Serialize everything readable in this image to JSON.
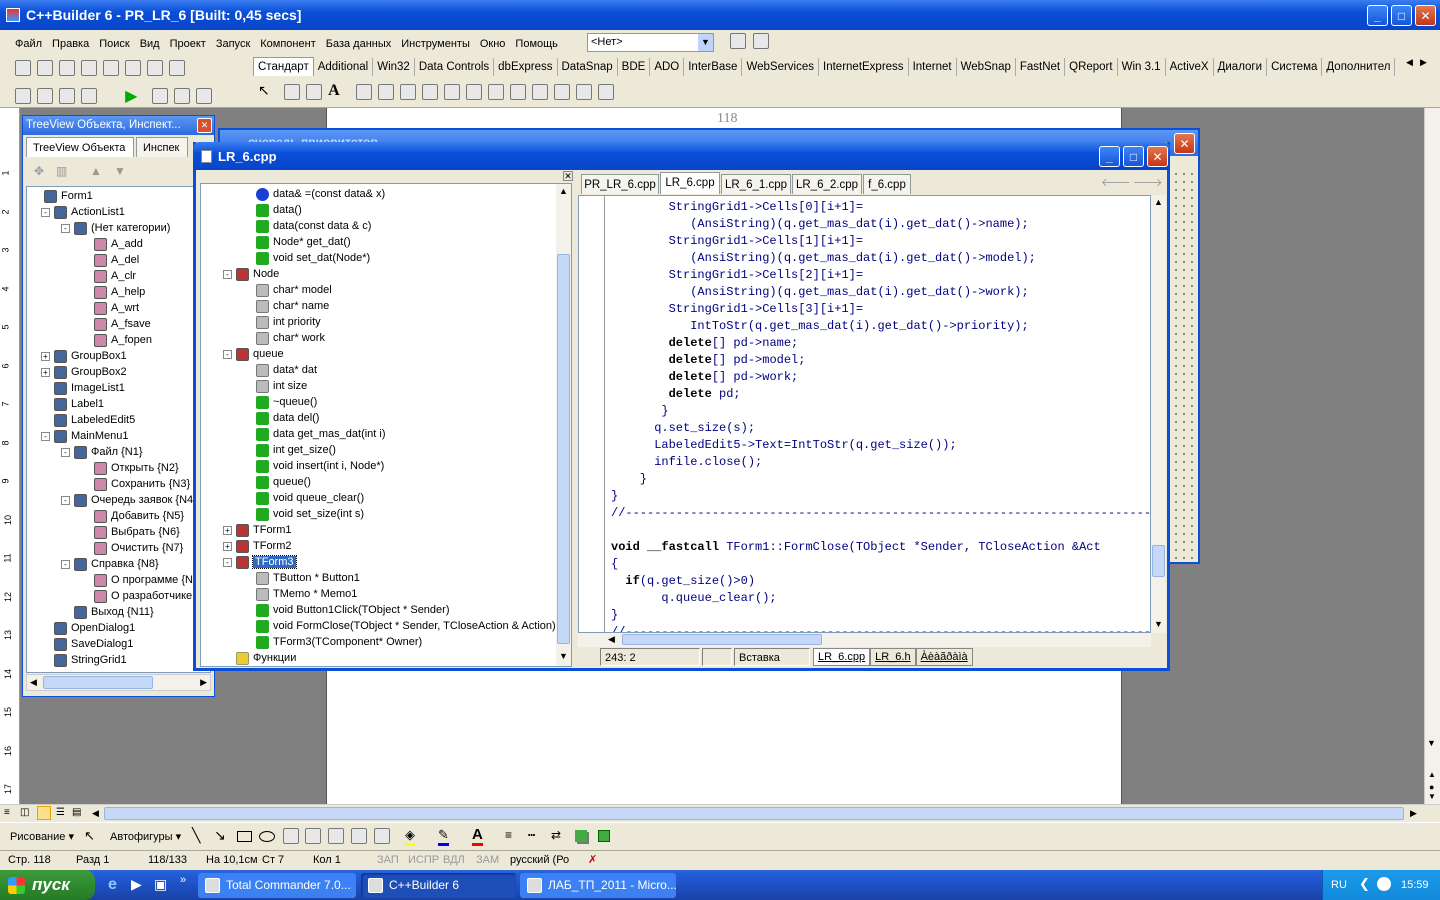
{
  "app": {
    "title": "C++Builder 6 - PR_LR_6 [Built: 0,45 secs]",
    "menu": [
      "Файл",
      "Правка",
      "Поиск",
      "Вид",
      "Проект",
      "Запуск",
      "Компонент",
      "База данных",
      "Инструменты",
      "Окно",
      "Помощь"
    ],
    "config_select": "<Нет>",
    "palette_tabs": [
      "Стандарт",
      "Additional",
      "Win32",
      "Data Controls",
      "dbExpress",
      "DataSnap",
      "BDE",
      "ADO",
      "InterBase",
      "WebServices",
      "InternetExpress",
      "Internet",
      "WebSnap",
      "FastNet",
      "QReport",
      "Win 3.1",
      "ActiveX",
      "Диалоги",
      "Система",
      "Дополнител"
    ]
  },
  "treeview": {
    "title": "TreeView Объекта, Инспект...",
    "tabs": [
      "TreeView Объекта",
      "Инспек"
    ],
    "items": [
      {
        "label": "Form1",
        "lvl": 0,
        "exp": ""
      },
      {
        "label": "ActionList1",
        "lvl": 1,
        "exp": "-"
      },
      {
        "label": "(Нет категории)",
        "lvl": 2,
        "exp": "-"
      },
      {
        "label": "A_add",
        "lvl": 3,
        "exp": ""
      },
      {
        "label": "A_del",
        "lvl": 3,
        "exp": ""
      },
      {
        "label": "A_clr",
        "lvl": 3,
        "exp": ""
      },
      {
        "label": "A_help",
        "lvl": 3,
        "exp": ""
      },
      {
        "label": "A_wrt",
        "lvl": 3,
        "exp": ""
      },
      {
        "label": "A_fsave",
        "lvl": 3,
        "exp": ""
      },
      {
        "label": "A_fopen",
        "lvl": 3,
        "exp": ""
      },
      {
        "label": "GroupBox1",
        "lvl": 1,
        "exp": "+"
      },
      {
        "label": "GroupBox2",
        "lvl": 1,
        "exp": "+"
      },
      {
        "label": "ImageList1",
        "lvl": 1,
        "exp": ""
      },
      {
        "label": "Label1",
        "lvl": 1,
        "exp": ""
      },
      {
        "label": "LabeledEdit5",
        "lvl": 1,
        "exp": ""
      },
      {
        "label": "MainMenu1",
        "lvl": 1,
        "exp": "-"
      },
      {
        "label": "Файл {N1}",
        "lvl": 2,
        "exp": "-"
      },
      {
        "label": "Открыть {N2}",
        "lvl": 3,
        "exp": ""
      },
      {
        "label": "Сохранить {N3}",
        "lvl": 3,
        "exp": ""
      },
      {
        "label": "Очередь заявок {N4",
        "lvl": 2,
        "exp": "-"
      },
      {
        "label": "Добавить {N5}",
        "lvl": 3,
        "exp": ""
      },
      {
        "label": "Выбрать {N6}",
        "lvl": 3,
        "exp": ""
      },
      {
        "label": "Очистить {N7}",
        "lvl": 3,
        "exp": ""
      },
      {
        "label": "Справка {N8}",
        "lvl": 2,
        "exp": "-"
      },
      {
        "label": "О программе {N",
        "lvl": 3,
        "exp": ""
      },
      {
        "label": "О разработчике",
        "lvl": 3,
        "exp": ""
      },
      {
        "label": "Выход {N11}",
        "lvl": 2,
        "exp": ""
      },
      {
        "label": "OpenDialog1",
        "lvl": 1,
        "exp": ""
      },
      {
        "label": "SaveDialog1",
        "lvl": 1,
        "exp": ""
      },
      {
        "label": "StringGrid1",
        "lvl": 1,
        "exp": ""
      }
    ]
  },
  "behind_window": {
    "title": "очередь приоритетов",
    "ruler_label": "118"
  },
  "editor": {
    "title": "LR_6.cpp",
    "tabs": [
      "PR_LR_6.cpp",
      "LR_6.cpp",
      "LR_6_1.cpp",
      "LR_6_2.cpp",
      "f_6.cpp"
    ],
    "active_tab": 1,
    "class_tree": [
      {
        "label": "data& =(const data& x)",
        "lvl": 2,
        "exp": "",
        "ic": "blue"
      },
      {
        "label": "data()",
        "lvl": 2,
        "exp": "",
        "ic": "green"
      },
      {
        "label": "data(const data & c)",
        "lvl": 2,
        "exp": "",
        "ic": "green"
      },
      {
        "label": "Node* get_dat()",
        "lvl": 2,
        "exp": "",
        "ic": "green"
      },
      {
        "label": "void set_dat(Node*)",
        "lvl": 2,
        "exp": "",
        "ic": "green"
      },
      {
        "label": "Node",
        "lvl": 1,
        "exp": "-",
        "ic": "class"
      },
      {
        "label": "char* model",
        "lvl": 2,
        "exp": "",
        "ic": "gray"
      },
      {
        "label": "char* name",
        "lvl": 2,
        "exp": "",
        "ic": "gray"
      },
      {
        "label": "int priority",
        "lvl": 2,
        "exp": "",
        "ic": "gray"
      },
      {
        "label": "char* work",
        "lvl": 2,
        "exp": "",
        "ic": "gray"
      },
      {
        "label": "queue",
        "lvl": 1,
        "exp": "-",
        "ic": "class"
      },
      {
        "label": "data* dat",
        "lvl": 2,
        "exp": "",
        "ic": "gray"
      },
      {
        "label": "int size",
        "lvl": 2,
        "exp": "",
        "ic": "gray"
      },
      {
        "label": "~queue()",
        "lvl": 2,
        "exp": "",
        "ic": "green"
      },
      {
        "label": "data del()",
        "lvl": 2,
        "exp": "",
        "ic": "green"
      },
      {
        "label": "data get_mas_dat(int i)",
        "lvl": 2,
        "exp": "",
        "ic": "green"
      },
      {
        "label": "int get_size()",
        "lvl": 2,
        "exp": "",
        "ic": "green"
      },
      {
        "label": "void insert(int i, Node*)",
        "lvl": 2,
        "exp": "",
        "ic": "green"
      },
      {
        "label": "queue()",
        "lvl": 2,
        "exp": "",
        "ic": "green"
      },
      {
        "label": "void queue_clear()",
        "lvl": 2,
        "exp": "",
        "ic": "green"
      },
      {
        "label": "void set_size(int s)",
        "lvl": 2,
        "exp": "",
        "ic": "green"
      },
      {
        "label": "TForm1",
        "lvl": 1,
        "exp": "+",
        "ic": "class"
      },
      {
        "label": "TForm2",
        "lvl": 1,
        "exp": "+",
        "ic": "class"
      },
      {
        "label": "TForm3",
        "lvl": 1,
        "exp": "-",
        "ic": "class",
        "sel": true
      },
      {
        "label": "TButton * Button1",
        "lvl": 2,
        "exp": "",
        "ic": "gray"
      },
      {
        "label": "TMemo * Memo1",
        "lvl": 2,
        "exp": "",
        "ic": "gray"
      },
      {
        "label": "void Button1Click(TObject * Sender)",
        "lvl": 2,
        "exp": "",
        "ic": "green"
      },
      {
        "label": "void FormClose(TObject * Sender, TCloseAction & Action)",
        "lvl": 2,
        "exp": "",
        "ic": "green"
      },
      {
        "label": "TForm3(TComponent* Owner)",
        "lvl": 2,
        "exp": "",
        "ic": "green"
      },
      {
        "label": "Функции",
        "lvl": 1,
        "exp": "",
        "ic": "folder"
      }
    ],
    "code": [
      "        StringGrid1->Cells[0][i+1]=",
      "           (AnsiString)(q.get_mas_dat(i).get_dat()->name);",
      "        StringGrid1->Cells[1][i+1]=",
      "           (AnsiString)(q.get_mas_dat(i).get_dat()->model);",
      "        StringGrid1->Cells[2][i+1]=",
      "           (AnsiString)(q.get_mas_dat(i).get_dat()->work);",
      "        StringGrid1->Cells[3][i+1]=",
      "           IntToStr(q.get_mas_dat(i).get_dat()->priority);",
      "        delete[] pd->name;",
      "        delete[] pd->model;",
      "        delete[] pd->work;",
      "        delete pd;",
      "       }",
      "      q.set_size(s);",
      "      LabeledEdit5->Text=IntToStr(q.get_size());",
      "      infile.close();",
      "    }",
      "}",
      "//---------------------------------------------------------------------------",
      "",
      "void __fastcall TForm1::FormClose(TObject *Sender, TCloseAction &Act",
      "{",
      "  if(q.get_size()>0)",
      "       q.queue_clear();",
      "}",
      "//---------------------------------------------------------------------------"
    ],
    "status": {
      "pos": "243:   2",
      "mode": "Вставка",
      "bottom_tabs": [
        "LR_6.cpp",
        "LR_6.h",
        "Àèàãðàìà"
      ]
    }
  },
  "word": {
    "drawing_label": "Рисование",
    "autoshapes_label": "Автофигуры",
    "status": [
      "Стр. 118",
      "Разд 1",
      "118/133",
      "На 10,1см",
      "Ст 7",
      "Кол 1",
      "ЗАП",
      "ИСПР",
      "ВДЛ",
      "ЗАМ",
      "русский (Ро"
    ],
    "ruler_numbers": [
      "1",
      "2",
      "3",
      "4",
      "5",
      "6",
      "7",
      "8",
      "9",
      "10",
      "11",
      "12",
      "13",
      "14",
      "15",
      "16",
      "17"
    ]
  },
  "taskbar": {
    "start": "пуск",
    "items": [
      "Total Commander 7.0...",
      "C++Builder 6",
      "ЛАБ_ТП_2011 - Micro..."
    ],
    "lang": "RU",
    "clock": "15:59"
  }
}
